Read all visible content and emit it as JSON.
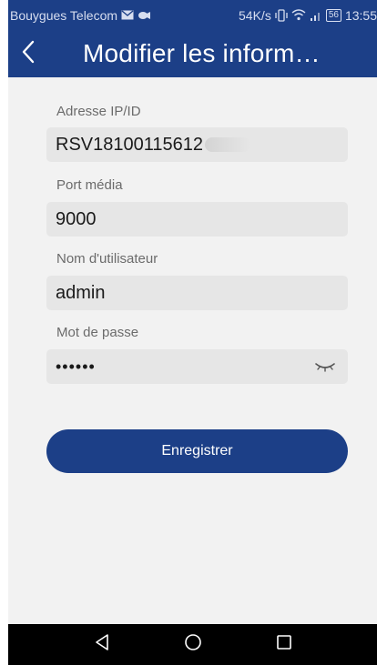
{
  "status_bar": {
    "carrier": "Bouygues Telecom",
    "speed": "54K/s",
    "battery": "56",
    "time": "13:55"
  },
  "app_bar": {
    "title": "Modifier les inform…"
  },
  "form": {
    "ip": {
      "label": "Adresse IP/ID",
      "value": "RSV18100115612"
    },
    "port": {
      "label": "Port média",
      "value": "9000"
    },
    "username": {
      "label": "Nom d'utilisateur",
      "value": "admin"
    },
    "password": {
      "label": "Mot de passe",
      "value": "••••••"
    }
  },
  "save_label": "Enregistrer",
  "icons": {
    "back": "chevron-left-icon",
    "eye": "eye-closed-icon",
    "nav_back": "triangle-back-icon",
    "nav_home": "circle-home-icon",
    "nav_recent": "square-recent-icon"
  },
  "colors": {
    "primary": "#1c3f87",
    "background": "#f2f2f2",
    "field": "#e6e6e6"
  }
}
